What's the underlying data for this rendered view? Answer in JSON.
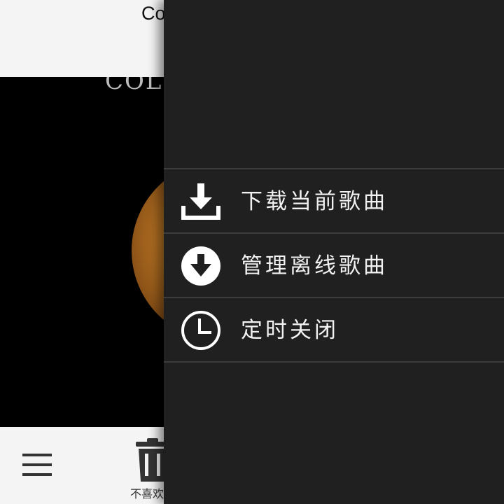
{
  "player": {
    "song_title": "Co",
    "album_caption": "COLL",
    "footer": {
      "menu_icon": "hamburger-menu-icon",
      "trash_icon": "trash-icon",
      "dislike_label": "不喜欢"
    }
  },
  "drawer": {
    "items": [
      {
        "label": "下载当前歌曲",
        "icon": "download-icon"
      },
      {
        "label": "管理离线歌曲",
        "icon": "circle-download-icon"
      },
      {
        "label": "定时关闭",
        "icon": "clock-icon"
      }
    ]
  },
  "colors": {
    "drawer_bg": "#202020",
    "drawer_text": "#f2f2f2",
    "divider": "#3c3c3c",
    "light_bg": "#f4f4f4"
  }
}
